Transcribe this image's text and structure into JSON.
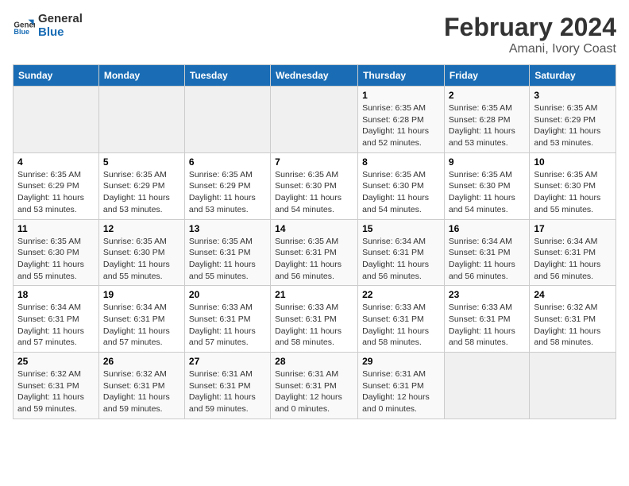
{
  "header": {
    "logo_line1": "General",
    "logo_line2": "Blue",
    "title": "February 2024",
    "subtitle": "Amani, Ivory Coast"
  },
  "days_of_week": [
    "Sunday",
    "Monday",
    "Tuesday",
    "Wednesday",
    "Thursday",
    "Friday",
    "Saturday"
  ],
  "weeks": [
    [
      {
        "day": "",
        "info": ""
      },
      {
        "day": "",
        "info": ""
      },
      {
        "day": "",
        "info": ""
      },
      {
        "day": "",
        "info": ""
      },
      {
        "day": "1",
        "info": "Sunrise: 6:35 AM\nSunset: 6:28 PM\nDaylight: 11 hours\nand 52 minutes."
      },
      {
        "day": "2",
        "info": "Sunrise: 6:35 AM\nSunset: 6:28 PM\nDaylight: 11 hours\nand 53 minutes."
      },
      {
        "day": "3",
        "info": "Sunrise: 6:35 AM\nSunset: 6:29 PM\nDaylight: 11 hours\nand 53 minutes."
      }
    ],
    [
      {
        "day": "4",
        "info": "Sunrise: 6:35 AM\nSunset: 6:29 PM\nDaylight: 11 hours\nand 53 minutes."
      },
      {
        "day": "5",
        "info": "Sunrise: 6:35 AM\nSunset: 6:29 PM\nDaylight: 11 hours\nand 53 minutes."
      },
      {
        "day": "6",
        "info": "Sunrise: 6:35 AM\nSunset: 6:29 PM\nDaylight: 11 hours\nand 53 minutes."
      },
      {
        "day": "7",
        "info": "Sunrise: 6:35 AM\nSunset: 6:30 PM\nDaylight: 11 hours\nand 54 minutes."
      },
      {
        "day": "8",
        "info": "Sunrise: 6:35 AM\nSunset: 6:30 PM\nDaylight: 11 hours\nand 54 minutes."
      },
      {
        "day": "9",
        "info": "Sunrise: 6:35 AM\nSunset: 6:30 PM\nDaylight: 11 hours\nand 54 minutes."
      },
      {
        "day": "10",
        "info": "Sunrise: 6:35 AM\nSunset: 6:30 PM\nDaylight: 11 hours\nand 55 minutes."
      }
    ],
    [
      {
        "day": "11",
        "info": "Sunrise: 6:35 AM\nSunset: 6:30 PM\nDaylight: 11 hours\nand 55 minutes."
      },
      {
        "day": "12",
        "info": "Sunrise: 6:35 AM\nSunset: 6:30 PM\nDaylight: 11 hours\nand 55 minutes."
      },
      {
        "day": "13",
        "info": "Sunrise: 6:35 AM\nSunset: 6:31 PM\nDaylight: 11 hours\nand 55 minutes."
      },
      {
        "day": "14",
        "info": "Sunrise: 6:35 AM\nSunset: 6:31 PM\nDaylight: 11 hours\nand 56 minutes."
      },
      {
        "day": "15",
        "info": "Sunrise: 6:34 AM\nSunset: 6:31 PM\nDaylight: 11 hours\nand 56 minutes."
      },
      {
        "day": "16",
        "info": "Sunrise: 6:34 AM\nSunset: 6:31 PM\nDaylight: 11 hours\nand 56 minutes."
      },
      {
        "day": "17",
        "info": "Sunrise: 6:34 AM\nSunset: 6:31 PM\nDaylight: 11 hours\nand 56 minutes."
      }
    ],
    [
      {
        "day": "18",
        "info": "Sunrise: 6:34 AM\nSunset: 6:31 PM\nDaylight: 11 hours\nand 57 minutes."
      },
      {
        "day": "19",
        "info": "Sunrise: 6:34 AM\nSunset: 6:31 PM\nDaylight: 11 hours\nand 57 minutes."
      },
      {
        "day": "20",
        "info": "Sunrise: 6:33 AM\nSunset: 6:31 PM\nDaylight: 11 hours\nand 57 minutes."
      },
      {
        "day": "21",
        "info": "Sunrise: 6:33 AM\nSunset: 6:31 PM\nDaylight: 11 hours\nand 58 minutes."
      },
      {
        "day": "22",
        "info": "Sunrise: 6:33 AM\nSunset: 6:31 PM\nDaylight: 11 hours\nand 58 minutes."
      },
      {
        "day": "23",
        "info": "Sunrise: 6:33 AM\nSunset: 6:31 PM\nDaylight: 11 hours\nand 58 minutes."
      },
      {
        "day": "24",
        "info": "Sunrise: 6:32 AM\nSunset: 6:31 PM\nDaylight: 11 hours\nand 58 minutes."
      }
    ],
    [
      {
        "day": "25",
        "info": "Sunrise: 6:32 AM\nSunset: 6:31 PM\nDaylight: 11 hours\nand 59 minutes."
      },
      {
        "day": "26",
        "info": "Sunrise: 6:32 AM\nSunset: 6:31 PM\nDaylight: 11 hours\nand 59 minutes."
      },
      {
        "day": "27",
        "info": "Sunrise: 6:31 AM\nSunset: 6:31 PM\nDaylight: 11 hours\nand 59 minutes."
      },
      {
        "day": "28",
        "info": "Sunrise: 6:31 AM\nSunset: 6:31 PM\nDaylight: 12 hours\nand 0 minutes."
      },
      {
        "day": "29",
        "info": "Sunrise: 6:31 AM\nSunset: 6:31 PM\nDaylight: 12 hours\nand 0 minutes."
      },
      {
        "day": "",
        "info": ""
      },
      {
        "day": "",
        "info": ""
      }
    ]
  ]
}
